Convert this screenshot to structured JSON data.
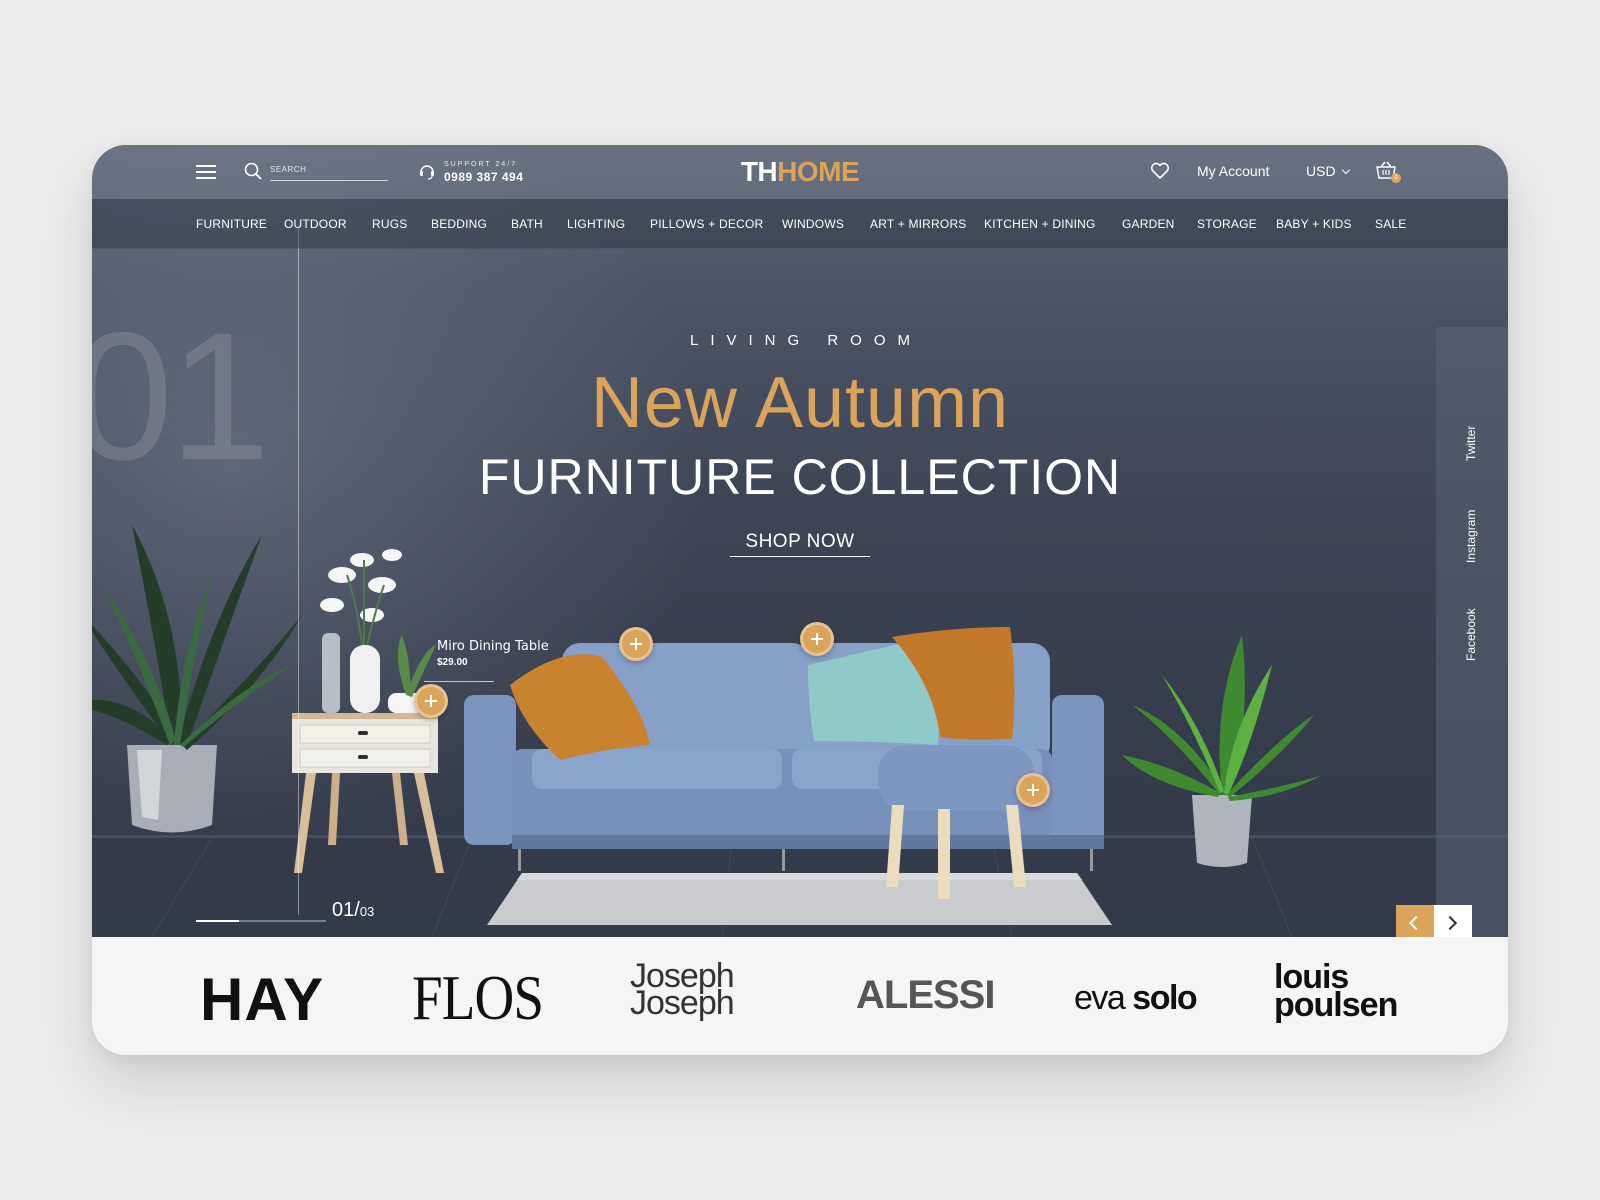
{
  "header": {
    "search_placeholder": "SEARCH",
    "support_label": "SUPPORT 24/7",
    "support_phone": "0989 387 494",
    "logo_part1": "TH",
    "logo_part2": "HOME",
    "account_label": "My Account",
    "currency": "USD",
    "cart_count": "0"
  },
  "nav": {
    "items": [
      "FURNITURE",
      "OUTDOOR",
      "RUGS",
      "BEDDING",
      "BATH",
      "LIGHTING",
      "PILLOWS + DECOR",
      "WINDOWS",
      "ART + MIRRORS",
      "KITCHEN + DINING",
      "GARDEN",
      "STORAGE",
      "BABY + KIDS",
      "SALE"
    ]
  },
  "hero": {
    "slide_number_bg": "01",
    "eyebrow": "LIVING ROOM",
    "headline": "New Autumn",
    "subheadline": "FURNITURE COLLECTION",
    "cta": "SHOP NOW",
    "product_name": "Miro Dining Table",
    "product_price": "$29.00",
    "slide_current": "01",
    "slide_separator": "/",
    "slide_total": "03",
    "slide_progress": 0.33
  },
  "social": {
    "items": [
      "Twitter",
      "Instagram",
      "Facebook"
    ]
  },
  "brands": {
    "hay": "HAY",
    "flos": "FLOS",
    "joseph_line1": "Joseph",
    "joseph_line2": "Joseph",
    "alessi": "ALESSI",
    "eva": "eva",
    "solo": "solo",
    "louis_line1": "louis",
    "louis_line2": "poulsen"
  },
  "colors": {
    "accent": "#dba45a",
    "hero_bg": "#3d4556",
    "brands_bg": "#f4f5f7"
  },
  "icons": {
    "menu": "hamburger-icon",
    "search": "search-icon",
    "support": "headset-icon",
    "wishlist": "heart-icon",
    "cart": "basket-icon",
    "hotspot": "plus-icon",
    "prev": "chevron-left-icon",
    "next": "chevron-right-icon"
  }
}
